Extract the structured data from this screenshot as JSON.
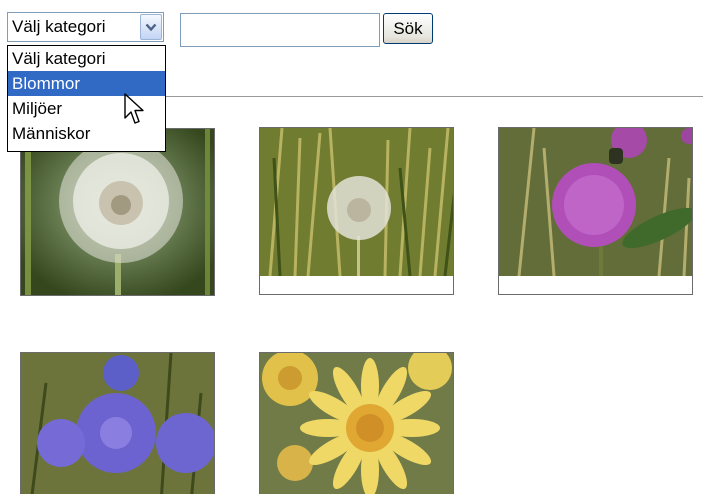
{
  "category_select": {
    "value": "Välj kategori",
    "options": [
      {
        "label": "Välj kategori"
      },
      {
        "label": "Blommor"
      },
      {
        "label": "Miljöer"
      },
      {
        "label": "Människor"
      }
    ],
    "highlighted_option": "Blommor",
    "highlight_color": "#316ac5"
  },
  "search": {
    "value": "",
    "button_label": "Sök"
  },
  "images": [
    {
      "subject": "dandelion seed head"
    },
    {
      "subject": "dandelion seed head in grass"
    },
    {
      "subject": "purple thistle flower"
    },
    {
      "subject": "blue bellflowers"
    },
    {
      "subject": "yellow daisy flower"
    }
  ]
}
